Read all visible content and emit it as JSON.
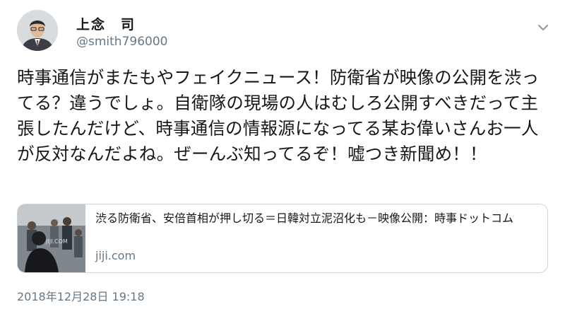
{
  "user": {
    "display_name": "上念　司",
    "handle": "@smith796000"
  },
  "tweet": {
    "text": "時事通信がまたもやフェイクニュース！防衛省が映像の公開を渋ってる？違うでしょ。自衛隊の現場の人はむしろ公開すべきだって主張したんだけど、時事通信の情報源になってる某お偉いさんお一人が反対なんだよね。ぜーんぶ知ってるぞ！嘘つき新聞め！！",
    "timestamp": "2018年12月28日 19:18"
  },
  "link_card": {
    "title": "渋る防衛省、安倍首相が押し切る＝日韓対立泥沼化も－映像公開：時事ドットコム",
    "domain": "jiji.com",
    "thumb_watermark": "JIJI.COM"
  },
  "icons": {
    "menu": "chevron-down-icon"
  }
}
